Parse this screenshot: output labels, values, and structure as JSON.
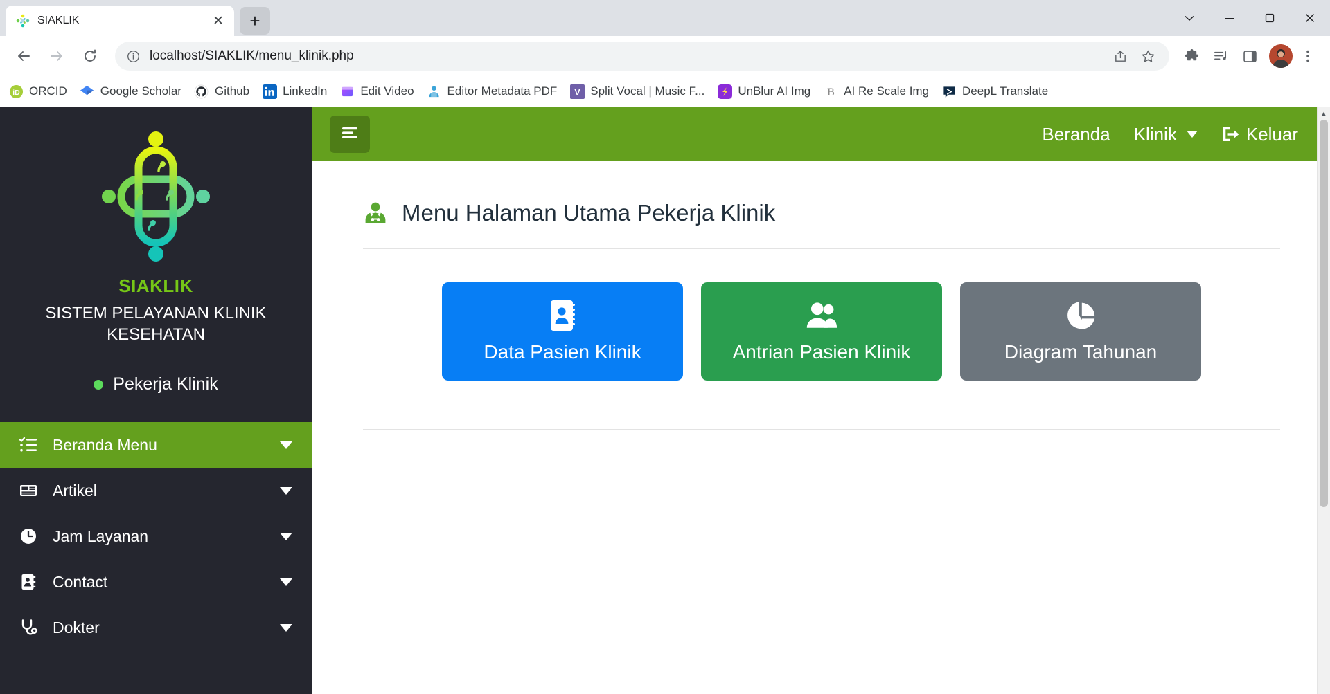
{
  "browser": {
    "tab": {
      "title": "SIAKLIK",
      "favicon": "siaklik-logo-icon",
      "close_label": "✕"
    },
    "new_tab_label": "+",
    "window_controls": {
      "minimize": "─",
      "maximize": "□",
      "close": "✕",
      "expand": "⌄"
    },
    "nav": {
      "back": "←",
      "forward": "→",
      "reload": "↻"
    },
    "omnibox": {
      "info_icon": "site-info-icon",
      "url_prefix": "localhost",
      "url_path": "/SIAKLIK/menu_klinik.php",
      "url_full": "localhost/SIAKLIK/menu_klinik.php",
      "share_icon": "share-icon",
      "bookmark_icon": "star-icon"
    },
    "toolbar_icons": [
      "extensions-puzzle-icon",
      "media-list-icon",
      "side-panel-icon",
      "profile-avatar",
      "more-menu-icon"
    ],
    "bookmarks": [
      {
        "label": "ORCID",
        "icon": "orcid-icon"
      },
      {
        "label": "Google Scholar",
        "icon": "google-scholar-icon"
      },
      {
        "label": "Github",
        "icon": "github-icon"
      },
      {
        "label": "LinkedIn",
        "icon": "linkedin-icon"
      },
      {
        "label": "Edit Video",
        "icon": "edit-video-icon"
      },
      {
        "label": "Editor Metadata PDF",
        "icon": "metadata-editor-icon"
      },
      {
        "label": "Split Vocal | Music F...",
        "icon": "split-vocal-icon"
      },
      {
        "label": "UnBlur AI Img",
        "icon": "unblur-icon"
      },
      {
        "label": "AI Re Scale Img",
        "icon": "rescale-icon"
      },
      {
        "label": "DeepL Translate",
        "icon": "deepl-icon"
      }
    ]
  },
  "sidebar": {
    "logo_icon": "siaklik-cross-logo",
    "brand_name": "SIAKLIK",
    "brand_subtitle": "SISTEM PELAYANAN KLINIK KESEHATAN",
    "user": {
      "name": "Pekerja Klinik",
      "status_color": "#5cdb5c"
    },
    "items": [
      {
        "label": "Beranda Menu",
        "icon": "list-check-icon",
        "active": true,
        "caret": "caret-down-icon"
      },
      {
        "label": "Artikel",
        "icon": "newspaper-icon",
        "active": false,
        "caret": "caret-down-icon"
      },
      {
        "label": "Jam Layanan",
        "icon": "clock-icon",
        "active": false,
        "caret": "caret-down-icon"
      },
      {
        "label": "Contact",
        "icon": "address-book-icon",
        "active": false,
        "caret": "caret-down-icon"
      },
      {
        "label": "Dokter",
        "icon": "stethoscope-icon",
        "active": false,
        "caret": "caret-down-icon"
      }
    ]
  },
  "topnav": {
    "toggle_icon": "hamburger-menu-icon",
    "links": [
      {
        "label": "Beranda",
        "icon": null,
        "caret": false
      },
      {
        "label": "Klinik",
        "icon": null,
        "caret": true
      },
      {
        "label": "Keluar",
        "icon": "sign-out-icon",
        "caret": false
      }
    ]
  },
  "main": {
    "heading": "Menu Halaman Utama Pekerja Klinik",
    "heading_icon": "user-doctor-icon",
    "cards": [
      {
        "label": "Data Pasien Klinik",
        "icon": "address-card-icon",
        "color": "#077ef5"
      },
      {
        "label": "Antrian Pasien Klinik",
        "icon": "users-icon",
        "color": "#2a9e4f"
      },
      {
        "label": "Diagram Tahunan",
        "icon": "pie-chart-icon",
        "color": "#6c757d"
      }
    ]
  },
  "colors": {
    "brand_green": "#64a01e",
    "sidebar_dark": "#25262f",
    "brand_text_green": "#76c717",
    "blue": "#077ef5",
    "green": "#2a9e4f",
    "gray": "#6c757d"
  },
  "scrollbar": {
    "up": "▲",
    "down": "▼"
  }
}
